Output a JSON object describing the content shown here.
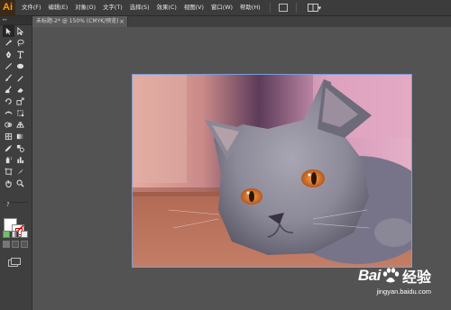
{
  "app": {
    "logo": "Ai"
  },
  "menubar": {
    "items": [
      "文件(F)",
      "编辑(E)",
      "对象(O)",
      "文字(T)",
      "选择(S)",
      "效果(C)",
      "视图(V)",
      "窗口(W)",
      "帮助(H)"
    ]
  },
  "document": {
    "tab_label": "未标题-2* @ 150% (CMYK/预览)",
    "close_glyph": "×"
  },
  "toolbox": {
    "grip_glyph": "▸▸",
    "help_glyph": "?"
  },
  "watermark": {
    "logo_bai": "Bai",
    "logo_du": "du",
    "logo_jingyan": "经验",
    "url": "jingyan.baidu.com"
  },
  "colors": {
    "accent_logo": "#ff9a00",
    "artboard_border": "#7b9cd9",
    "workspace_bg": "#535353",
    "panel_bg": "#3f3f3f"
  }
}
